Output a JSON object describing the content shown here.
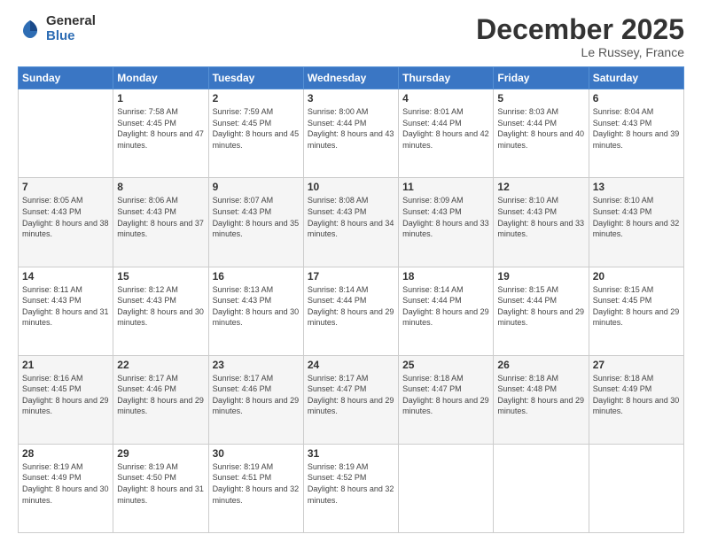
{
  "logo": {
    "general": "General",
    "blue": "Blue"
  },
  "title": {
    "month": "December 2025",
    "location": "Le Russey, France"
  },
  "header_days": [
    "Sunday",
    "Monday",
    "Tuesday",
    "Wednesday",
    "Thursday",
    "Friday",
    "Saturday"
  ],
  "weeks": [
    [
      {
        "date": "",
        "sunrise": "",
        "sunset": "",
        "daylight": ""
      },
      {
        "date": "1",
        "sunrise": "Sunrise: 7:58 AM",
        "sunset": "Sunset: 4:45 PM",
        "daylight": "Daylight: 8 hours and 47 minutes."
      },
      {
        "date": "2",
        "sunrise": "Sunrise: 7:59 AM",
        "sunset": "Sunset: 4:45 PM",
        "daylight": "Daylight: 8 hours and 45 minutes."
      },
      {
        "date": "3",
        "sunrise": "Sunrise: 8:00 AM",
        "sunset": "Sunset: 4:44 PM",
        "daylight": "Daylight: 8 hours and 43 minutes."
      },
      {
        "date": "4",
        "sunrise": "Sunrise: 8:01 AM",
        "sunset": "Sunset: 4:44 PM",
        "daylight": "Daylight: 8 hours and 42 minutes."
      },
      {
        "date": "5",
        "sunrise": "Sunrise: 8:03 AM",
        "sunset": "Sunset: 4:44 PM",
        "daylight": "Daylight: 8 hours and 40 minutes."
      },
      {
        "date": "6",
        "sunrise": "Sunrise: 8:04 AM",
        "sunset": "Sunset: 4:43 PM",
        "daylight": "Daylight: 8 hours and 39 minutes."
      }
    ],
    [
      {
        "date": "7",
        "sunrise": "Sunrise: 8:05 AM",
        "sunset": "Sunset: 4:43 PM",
        "daylight": "Daylight: 8 hours and 38 minutes."
      },
      {
        "date": "8",
        "sunrise": "Sunrise: 8:06 AM",
        "sunset": "Sunset: 4:43 PM",
        "daylight": "Daylight: 8 hours and 37 minutes."
      },
      {
        "date": "9",
        "sunrise": "Sunrise: 8:07 AM",
        "sunset": "Sunset: 4:43 PM",
        "daylight": "Daylight: 8 hours and 35 minutes."
      },
      {
        "date": "10",
        "sunrise": "Sunrise: 8:08 AM",
        "sunset": "Sunset: 4:43 PM",
        "daylight": "Daylight: 8 hours and 34 minutes."
      },
      {
        "date": "11",
        "sunrise": "Sunrise: 8:09 AM",
        "sunset": "Sunset: 4:43 PM",
        "daylight": "Daylight: 8 hours and 33 minutes."
      },
      {
        "date": "12",
        "sunrise": "Sunrise: 8:10 AM",
        "sunset": "Sunset: 4:43 PM",
        "daylight": "Daylight: 8 hours and 33 minutes."
      },
      {
        "date": "13",
        "sunrise": "Sunrise: 8:10 AM",
        "sunset": "Sunset: 4:43 PM",
        "daylight": "Daylight: 8 hours and 32 minutes."
      }
    ],
    [
      {
        "date": "14",
        "sunrise": "Sunrise: 8:11 AM",
        "sunset": "Sunset: 4:43 PM",
        "daylight": "Daylight: 8 hours and 31 minutes."
      },
      {
        "date": "15",
        "sunrise": "Sunrise: 8:12 AM",
        "sunset": "Sunset: 4:43 PM",
        "daylight": "Daylight: 8 hours and 30 minutes."
      },
      {
        "date": "16",
        "sunrise": "Sunrise: 8:13 AM",
        "sunset": "Sunset: 4:43 PM",
        "daylight": "Daylight: 8 hours and 30 minutes."
      },
      {
        "date": "17",
        "sunrise": "Sunrise: 8:14 AM",
        "sunset": "Sunset: 4:44 PM",
        "daylight": "Daylight: 8 hours and 29 minutes."
      },
      {
        "date": "18",
        "sunrise": "Sunrise: 8:14 AM",
        "sunset": "Sunset: 4:44 PM",
        "daylight": "Daylight: 8 hours and 29 minutes."
      },
      {
        "date": "19",
        "sunrise": "Sunrise: 8:15 AM",
        "sunset": "Sunset: 4:44 PM",
        "daylight": "Daylight: 8 hours and 29 minutes."
      },
      {
        "date": "20",
        "sunrise": "Sunrise: 8:15 AM",
        "sunset": "Sunset: 4:45 PM",
        "daylight": "Daylight: 8 hours and 29 minutes."
      }
    ],
    [
      {
        "date": "21",
        "sunrise": "Sunrise: 8:16 AM",
        "sunset": "Sunset: 4:45 PM",
        "daylight": "Daylight: 8 hours and 29 minutes."
      },
      {
        "date": "22",
        "sunrise": "Sunrise: 8:17 AM",
        "sunset": "Sunset: 4:46 PM",
        "daylight": "Daylight: 8 hours and 29 minutes."
      },
      {
        "date": "23",
        "sunrise": "Sunrise: 8:17 AM",
        "sunset": "Sunset: 4:46 PM",
        "daylight": "Daylight: 8 hours and 29 minutes."
      },
      {
        "date": "24",
        "sunrise": "Sunrise: 8:17 AM",
        "sunset": "Sunset: 4:47 PM",
        "daylight": "Daylight: 8 hours and 29 minutes."
      },
      {
        "date": "25",
        "sunrise": "Sunrise: 8:18 AM",
        "sunset": "Sunset: 4:47 PM",
        "daylight": "Daylight: 8 hours and 29 minutes."
      },
      {
        "date": "26",
        "sunrise": "Sunrise: 8:18 AM",
        "sunset": "Sunset: 4:48 PM",
        "daylight": "Daylight: 8 hours and 29 minutes."
      },
      {
        "date": "27",
        "sunrise": "Sunrise: 8:18 AM",
        "sunset": "Sunset: 4:49 PM",
        "daylight": "Daylight: 8 hours and 30 minutes."
      }
    ],
    [
      {
        "date": "28",
        "sunrise": "Sunrise: 8:19 AM",
        "sunset": "Sunset: 4:49 PM",
        "daylight": "Daylight: 8 hours and 30 minutes."
      },
      {
        "date": "29",
        "sunrise": "Sunrise: 8:19 AM",
        "sunset": "Sunset: 4:50 PM",
        "daylight": "Daylight: 8 hours and 31 minutes."
      },
      {
        "date": "30",
        "sunrise": "Sunrise: 8:19 AM",
        "sunset": "Sunset: 4:51 PM",
        "daylight": "Daylight: 8 hours and 32 minutes."
      },
      {
        "date": "31",
        "sunrise": "Sunrise: 8:19 AM",
        "sunset": "Sunset: 4:52 PM",
        "daylight": "Daylight: 8 hours and 32 minutes."
      },
      {
        "date": "",
        "sunrise": "",
        "sunset": "",
        "daylight": ""
      },
      {
        "date": "",
        "sunrise": "",
        "sunset": "",
        "daylight": ""
      },
      {
        "date": "",
        "sunrise": "",
        "sunset": "",
        "daylight": ""
      }
    ]
  ]
}
